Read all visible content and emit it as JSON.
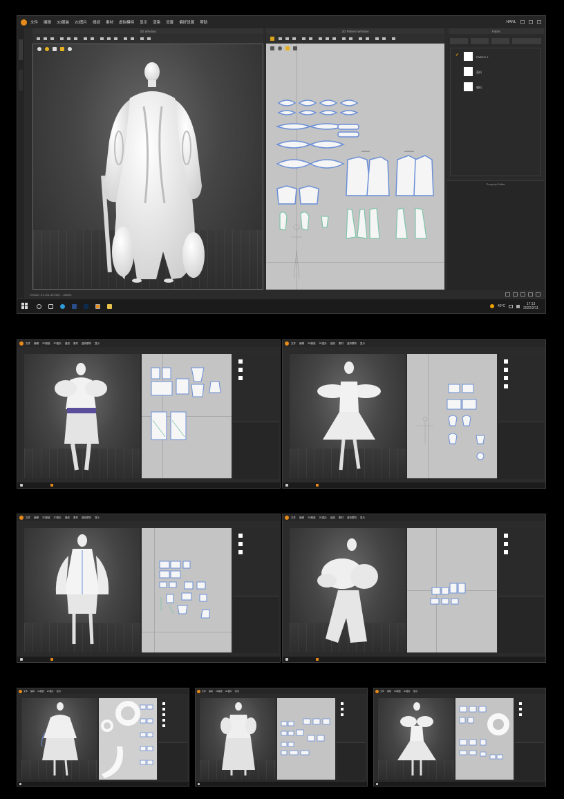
{
  "main": {
    "menu": [
      "文件",
      "编辑",
      "3D服装",
      "2D图片",
      "缝纫",
      "素材",
      "虚拟模特",
      "显示",
      "渲染",
      "设置",
      "偏好设置",
      "帮助"
    ],
    "user": "HANL",
    "view3d_title": "3D Window",
    "view2d_title": "2D Pattern Window",
    "objects_title": "Fabric",
    "property_title": "Property Editor",
    "fabric_items": [
      {
        "label": "FABRIC 1",
        "selected": true
      },
      {
        "label": "面料",
        "selected": false
      },
      {
        "label": "辅料",
        "selected": false
      }
    ],
    "version": "Version: 5.1.401.43733(r... 18664)",
    "tray_temp": "40°C",
    "clock_time": "17:13",
    "clock_date": "2022/2/11"
  },
  "thumbnails": [
    {
      "menu": [
        "文件",
        "编辑",
        "3D服装",
        "2D图片",
        "缝纫",
        "素材",
        "虚拟模特",
        "显示"
      ]
    },
    {
      "menu": [
        "文件",
        "编辑",
        "3D服装",
        "2D图片",
        "缝纫",
        "素材",
        "虚拟模特",
        "显示"
      ]
    },
    {
      "menu": [
        "文件",
        "编辑",
        "3D服装",
        "2D图片",
        "缝纫",
        "素材",
        "虚拟模特",
        "显示"
      ]
    },
    {
      "menu": [
        "文件",
        "编辑",
        "3D服装",
        "2D图片",
        "缝纫",
        "素材",
        "虚拟模特",
        "显示"
      ]
    },
    {
      "menu": [
        "文件",
        "编辑",
        "3D服装",
        "2D图片",
        "缝纫"
      ]
    },
    {
      "menu": [
        "文件",
        "编辑",
        "3D服装",
        "2D图片",
        "缝纫"
      ]
    },
    {
      "menu": [
        "文件",
        "编辑",
        "3D服装",
        "2D图片",
        "缝纫"
      ]
    }
  ],
  "colors": {
    "app_logo": "#e88a1a",
    "pattern_outline": "#6b8fd6",
    "seam_line": "#7fc4a8",
    "pattern_bg": "#c4c4c4"
  },
  "icons": [
    "app-logo-icon",
    "windows-start-icon",
    "search-icon",
    "task-view-icon",
    "edge-icon",
    "photoshop-icon",
    "clo-icon",
    "explorer-icon",
    "volume-icon",
    "network-icon"
  ]
}
